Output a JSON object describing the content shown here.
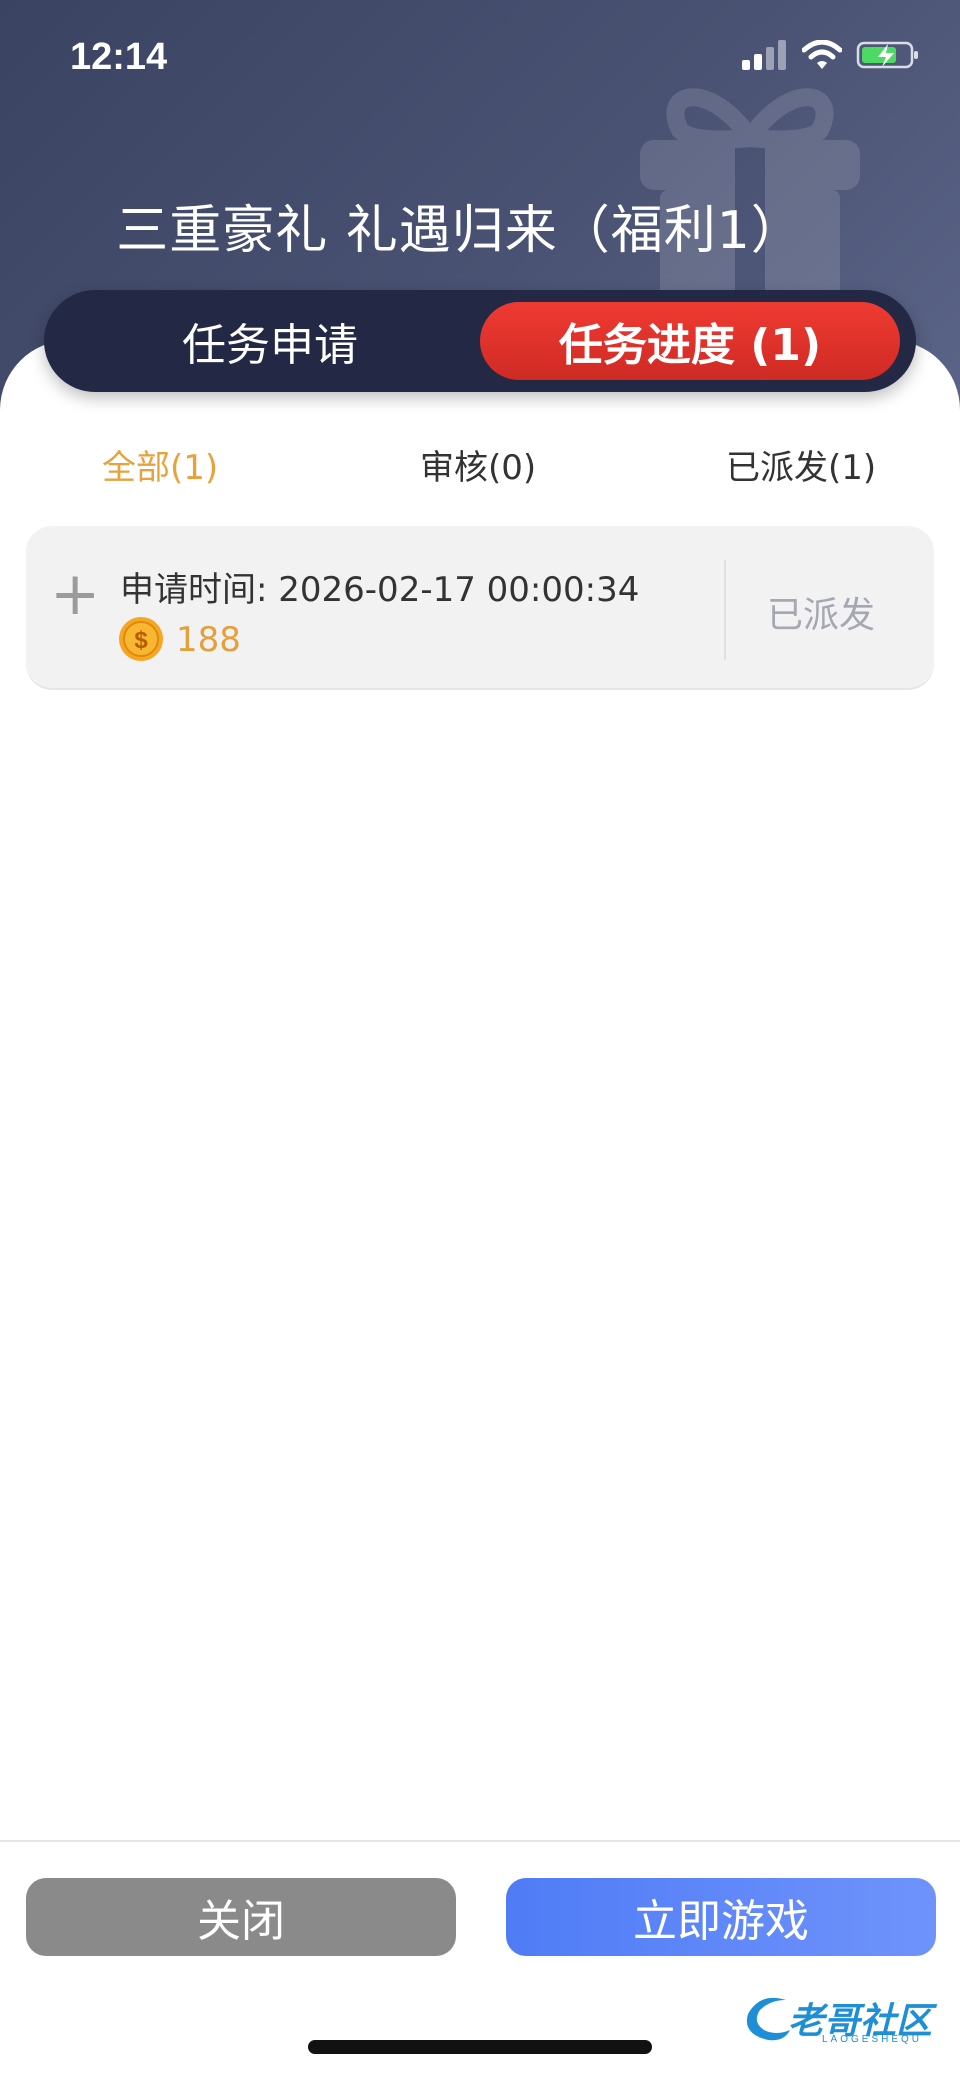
{
  "status_bar": {
    "time": "12:14"
  },
  "header": {
    "title": "三重豪礼 礼遇归来（福利1）"
  },
  "segments": [
    {
      "label": "任务申请",
      "active": false
    },
    {
      "label": "任务进度 (1)",
      "active": true
    }
  ],
  "filters": [
    {
      "label": "全部(1)",
      "active": true
    },
    {
      "label": "审核(0)",
      "active": false
    },
    {
      "label": "已派发(1)",
      "active": false
    }
  ],
  "records": [
    {
      "apply_time": "申请时间: 2026-02-17 00:00:34",
      "coins": "188",
      "status": "已派发"
    }
  ],
  "footer": {
    "close_label": "关闭",
    "play_label": "立即游戏"
  },
  "watermark": {
    "text": "老哥社区",
    "sub": "LAOGESHEQU"
  },
  "icons": [
    "signal-icon",
    "wifi-icon",
    "battery-charging-icon",
    "gift-icon",
    "plus-icon",
    "coin-icon"
  ],
  "colors": {
    "accent_red": "#e5322b",
    "accent_gold": "#e8a23c",
    "play_blue": "#5b86f8",
    "close_gray": "#8a8a8a"
  }
}
